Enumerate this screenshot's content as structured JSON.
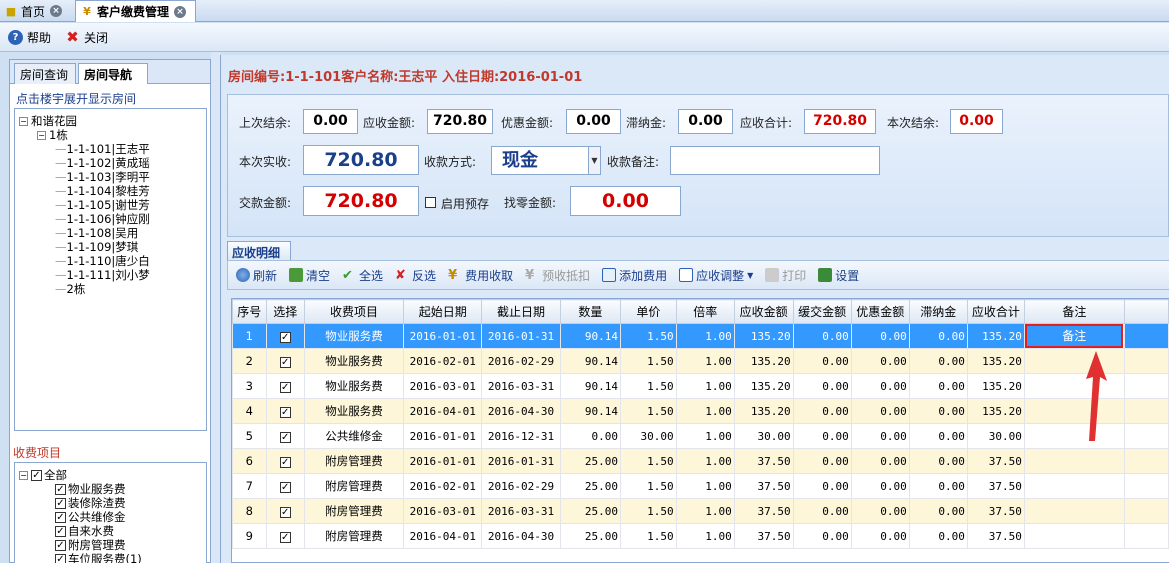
{
  "tabs": {
    "home": "首页",
    "active": "客户缴费管理"
  },
  "toolbar": {
    "help": "帮助",
    "close": "关闭"
  },
  "left": {
    "tab_query": "房间查询",
    "tab_nav": "房间导航",
    "hint": "点击楼宇展开显示房间",
    "tree": {
      "root": "和谐花园",
      "building1": "1栋",
      "rooms": [
        "1-1-101|王志平",
        "1-1-102|黄成瑶",
        "1-1-103|李明平",
        "1-1-104|黎桂芳",
        "1-1-105|谢世芳",
        "1-1-106|钟应刚",
        "1-1-108|吴用",
        "1-1-109|梦琪",
        "1-1-110|唐少白",
        "1-1-111|刘小梦"
      ],
      "building2": "2栋"
    },
    "fee_title": "收费项目",
    "fee_items": [
      "全部",
      "物业服务费",
      "装修除渣费",
      "公共维修金",
      "自来水费",
      "附房管理费",
      "车位服务费(1)"
    ]
  },
  "room_info": "房间编号:1-1-101客户名称:王志平 入住日期:2016-01-01",
  "form": {
    "last_balance_label": "上次结余:",
    "last_balance": "0.00",
    "due_label": "应收金额:",
    "due": "720.80",
    "discount_label": "优惠金额:",
    "discount": "0.00",
    "late_label": "滞纳金:",
    "late": "0.00",
    "total_label": "应收合计:",
    "total": "720.80",
    "this_balance_label": "本次结余:",
    "this_balance": "0.00",
    "received_label": "本次实收:",
    "received": "720.80",
    "method_label": "收款方式:",
    "method": "现金",
    "remark_label": "收款备注:",
    "remark": "",
    "pay_label": "交款金额:",
    "pay": "720.80",
    "prepay_label": "启用预存",
    "change_label": "找零金额:",
    "change": "0.00"
  },
  "detail": {
    "title": "应收明细",
    "buttons": {
      "refresh": "刷新",
      "clear": "清空",
      "select_all": "全选",
      "invert": "反选",
      "collect": "费用收取",
      "prepay_offset": "预收抵扣",
      "add_fee": "添加费用",
      "adjust": "应收调整",
      "print": "打印",
      "settings": "设置"
    }
  },
  "table": {
    "headers": [
      "序号",
      "选择",
      "收费项目",
      "起始日期",
      "截止日期",
      "数量",
      "单价",
      "倍率",
      "应收金额",
      "缓交金额",
      "优惠金额",
      "滞纳金",
      "应收合计",
      "备注"
    ],
    "note_button": "备注",
    "rows": [
      [
        "1",
        "物业服务费",
        "2016-01-01",
        "2016-01-31",
        "90.14",
        "1.50",
        "1.00",
        "135.20",
        "0.00",
        "0.00",
        "0.00",
        "135.20"
      ],
      [
        "2",
        "物业服务费",
        "2016-02-01",
        "2016-02-29",
        "90.14",
        "1.50",
        "1.00",
        "135.20",
        "0.00",
        "0.00",
        "0.00",
        "135.20"
      ],
      [
        "3",
        "物业服务费",
        "2016-03-01",
        "2016-03-31",
        "90.14",
        "1.50",
        "1.00",
        "135.20",
        "0.00",
        "0.00",
        "0.00",
        "135.20"
      ],
      [
        "4",
        "物业服务费",
        "2016-04-01",
        "2016-04-30",
        "90.14",
        "1.50",
        "1.00",
        "135.20",
        "0.00",
        "0.00",
        "0.00",
        "135.20"
      ],
      [
        "5",
        "公共维修金",
        "2016-01-01",
        "2016-12-31",
        "0.00",
        "30.00",
        "1.00",
        "30.00",
        "0.00",
        "0.00",
        "0.00",
        "30.00"
      ],
      [
        "6",
        "附房管理费",
        "2016-01-01",
        "2016-01-31",
        "25.00",
        "1.50",
        "1.00",
        "37.50",
        "0.00",
        "0.00",
        "0.00",
        "37.50"
      ],
      [
        "7",
        "附房管理费",
        "2016-02-01",
        "2016-02-29",
        "25.00",
        "1.50",
        "1.00",
        "37.50",
        "0.00",
        "0.00",
        "0.00",
        "37.50"
      ],
      [
        "8",
        "附房管理费",
        "2016-03-01",
        "2016-03-31",
        "25.00",
        "1.50",
        "1.00",
        "37.50",
        "0.00",
        "0.00",
        "0.00",
        "37.50"
      ],
      [
        "9",
        "附房管理费",
        "2016-04-01",
        "2016-04-30",
        "25.00",
        "1.50",
        "1.00",
        "37.50",
        "0.00",
        "0.00",
        "0.00",
        "37.50"
      ]
    ]
  },
  "colors": {
    "accent_red": "#d40000",
    "selection": "#3399ff",
    "row_alt": "#fdf6d8"
  }
}
